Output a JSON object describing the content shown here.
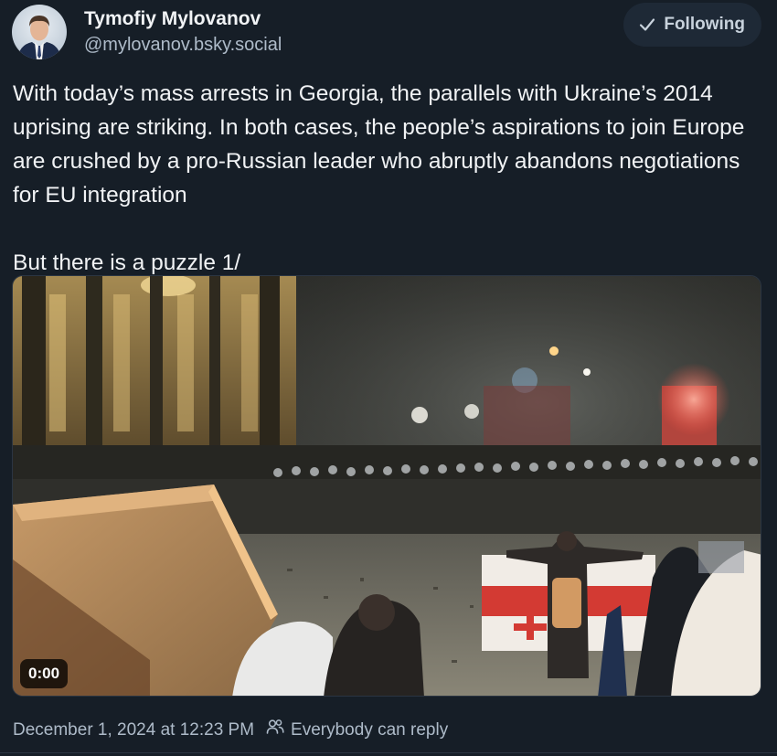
{
  "author": {
    "display_name": "Tymofiy Mylovanov",
    "handle": "@mylovanov.bsky.social",
    "avatar_icon": "user-avatar-photo"
  },
  "follow_button": {
    "label": "Following",
    "icon": "checkmark-icon"
  },
  "post": {
    "text": "With today’s mass arrests in Georgia, the parallels with Ukraine’s 2014 uprising are striking. In both cases, the people’s aspirations to join Europe are crushed by a pro-Russian leader who abruptly abandons negotiations for EU integration\n\nBut there is a puzzle 1/"
  },
  "video": {
    "timecode": "0:00"
  },
  "meta": {
    "timestamp": "December 1, 2024 at 12:23 PM",
    "reply_setting": "Everybody can reply",
    "reply_icon": "people-icon"
  },
  "colors": {
    "background": "#161e27",
    "text_primary": "#f1f3f5",
    "text_secondary": "#aebbc9",
    "button_bg": "#1e2936"
  }
}
